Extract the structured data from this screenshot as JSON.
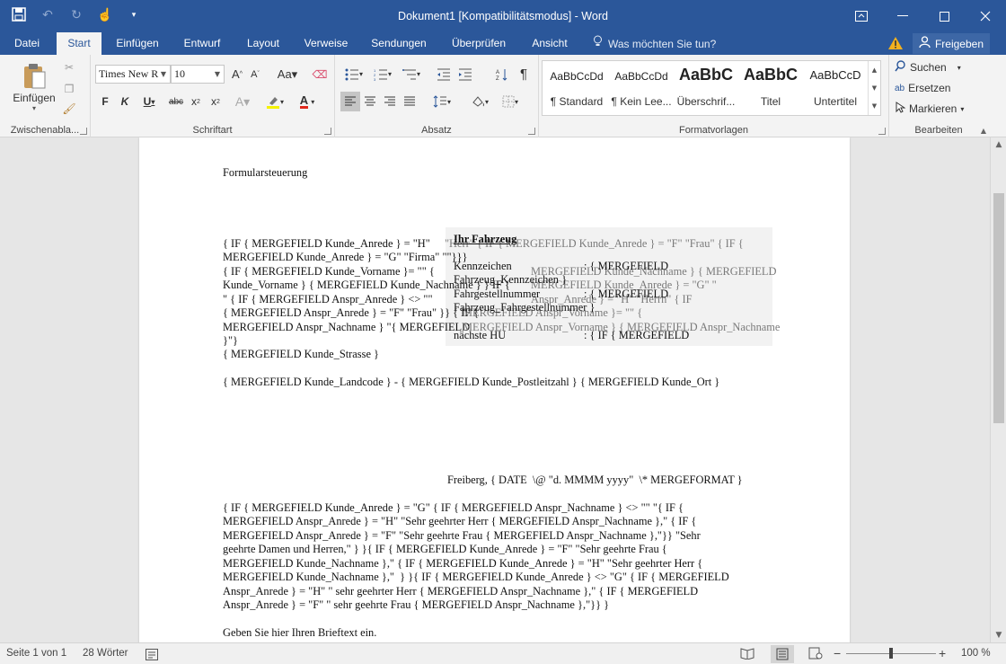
{
  "window": {
    "title": "Dokument1 [Kompatibilitätsmodus] - Word"
  },
  "tabs": [
    {
      "label": "Datei"
    },
    {
      "label": "Start"
    },
    {
      "label": "Einfügen"
    },
    {
      "label": "Entwurf"
    },
    {
      "label": "Layout"
    },
    {
      "label": "Verweise"
    },
    {
      "label": "Sendungen"
    },
    {
      "label": "Überprüfen"
    },
    {
      "label": "Ansicht"
    }
  ],
  "tell_me": "Was möchten Sie tun?",
  "share_label": "Freigeben",
  "ribbon": {
    "clipboard": {
      "paste_label": "Einfügen",
      "group_label": "Zwischenabla..."
    },
    "font": {
      "font_name": "Times New R",
      "font_size": "10",
      "group_label": "Schriftart"
    },
    "paragraph": {
      "group_label": "Absatz"
    },
    "styles": {
      "group_label": "Formatvorlagen",
      "items": [
        {
          "sample": "AaBbCcDd",
          "name": "¶ Standard"
        },
        {
          "sample": "AaBbCcDd",
          "name": "¶ Kein Lee..."
        },
        {
          "sample": "AaBbC",
          "name": "Überschrif..."
        },
        {
          "sample": "AaBbC",
          "name": "Titel"
        },
        {
          "sample": "AaBbCcD",
          "name": "Untertitel"
        }
      ]
    },
    "editing": {
      "find": "Suchen",
      "replace": "Ersetzen",
      "select": "Markieren",
      "group_label": "Bearbeiten"
    }
  },
  "document": {
    "heading": "Formularsteuerung",
    "anrede_lines": [
      "{ IF { MERGEFIELD Kunde_Anrede } = \"H\"",
      "MERGEFIELD Kunde_Anrede } = \"G\" \"Firma\" \"\"}}}",
      "{ IF { MERGEFIELD Kunde_Vorname }= \"\" {",
      "Kunde_Vorname } { MERGEFIELD Kunde_Nachname } } IF {",
      "\" { IF { MERGEFIELD Anspr_Anrede } <> \"\"",
      "{ MERGEFIELD Anspr_Anrede } = \"F\" \"Frau\" }} { IF {",
      "MERGEFIELD Anspr_Nachname } \"{ MERGEFIELD",
      "}\"}"
    ],
    "overlap_grey_lines": [
      "\"Herr\" { IF { MERGEFIELD Kunde_Anrede } = \"F\" \"Frau\" { IF {",
      "MERGEFIELD Kunde_Nachname } { MERGEFIELD",
      "MERGEFIELD Kunde_Anrede } = \"G\" \"",
      "Anspr_Anrede } = \"H\" \"Herrn\" { IF",
      "MERGEFIELD Anspr_Vorname }= \"\" {",
      "MERGEFIELD Anspr_Vorname } { MERGEFIELD Anspr_Nachname"
    ],
    "strasse": "{ MERGEFIELD Kunde_Strasse }",
    "ort_line": "{ MERGEFIELD Kunde_Landcode } - { MERGEFIELD Kunde_Postleitzahl } { MERGEFIELD Kunde_Ort }",
    "date_line": "Freiberg, { DATE  \\@ \"d. MMMM yyyy\"  \\* MERGEFORMAT }",
    "greeting_lines": [
      "{ IF { MERGEFIELD Kunde_Anrede } = \"G\" { IF { MERGEFIELD Anspr_Nachname } <> \"\" \"{ IF {",
      "MERGEFIELD Anspr_Anrede } = \"H\" \"Sehr geehrter Herr { MERGEFIELD Anspr_Nachname },\" { IF {",
      "MERGEFIELD Anspr_Anrede } = \"F\" \"Sehr geehrte Frau { MERGEFIELD Anspr_Nachname },\"}} \"Sehr",
      "geehrte Damen und Herren,\" } }{ IF { MERGEFIELD Kunde_Anrede } = \"F\" \"Sehr geehrte Frau {",
      "MERGEFIELD Kunde_Nachname },\" { IF { MERGEFIELD Kunde_Anrede } = \"H\" \"Sehr geehrter Herr {",
      "MERGEFIELD Kunde_Nachname },\"  } }{ IF { MERGEFIELD Kunde_Anrede } <> \"G\" { IF { MERGEFIELD",
      "Anspr_Anrede } = \"H\" \" sehr geehrter Herr { MERGEFIELD Anspr_Nachname },\" { IF { MERGEFIELD",
      "Anspr_Anrede } = \"F\" \" sehr geehrte Frau { MERGEFIELD Anspr_Nachname },\"}} }"
    ],
    "body_text": "Geben Sie hier Ihren Brieftext ein.",
    "fahrzeug": {
      "title": "Ihr Fahrzeug",
      "kennzeichen_label": "Kennzeichen",
      "kennzeichen_field": "Fahrzeug_Kennzeichen }",
      "kennzeichen_value": ": { MERGEFIELD",
      "fgst_label": "Fahrgestellnummer",
      "fgst_field": "Fahrzeug_Fahrgestellnummer }",
      "fgst_value": ": { MERGEFIELD",
      "hu_label": "nächste HU",
      "hu_value": ": { IF { MERGEFIELD"
    }
  },
  "status": {
    "page": "Seite 1 von 1",
    "words": "28 Wörter",
    "zoom": "100 %"
  }
}
